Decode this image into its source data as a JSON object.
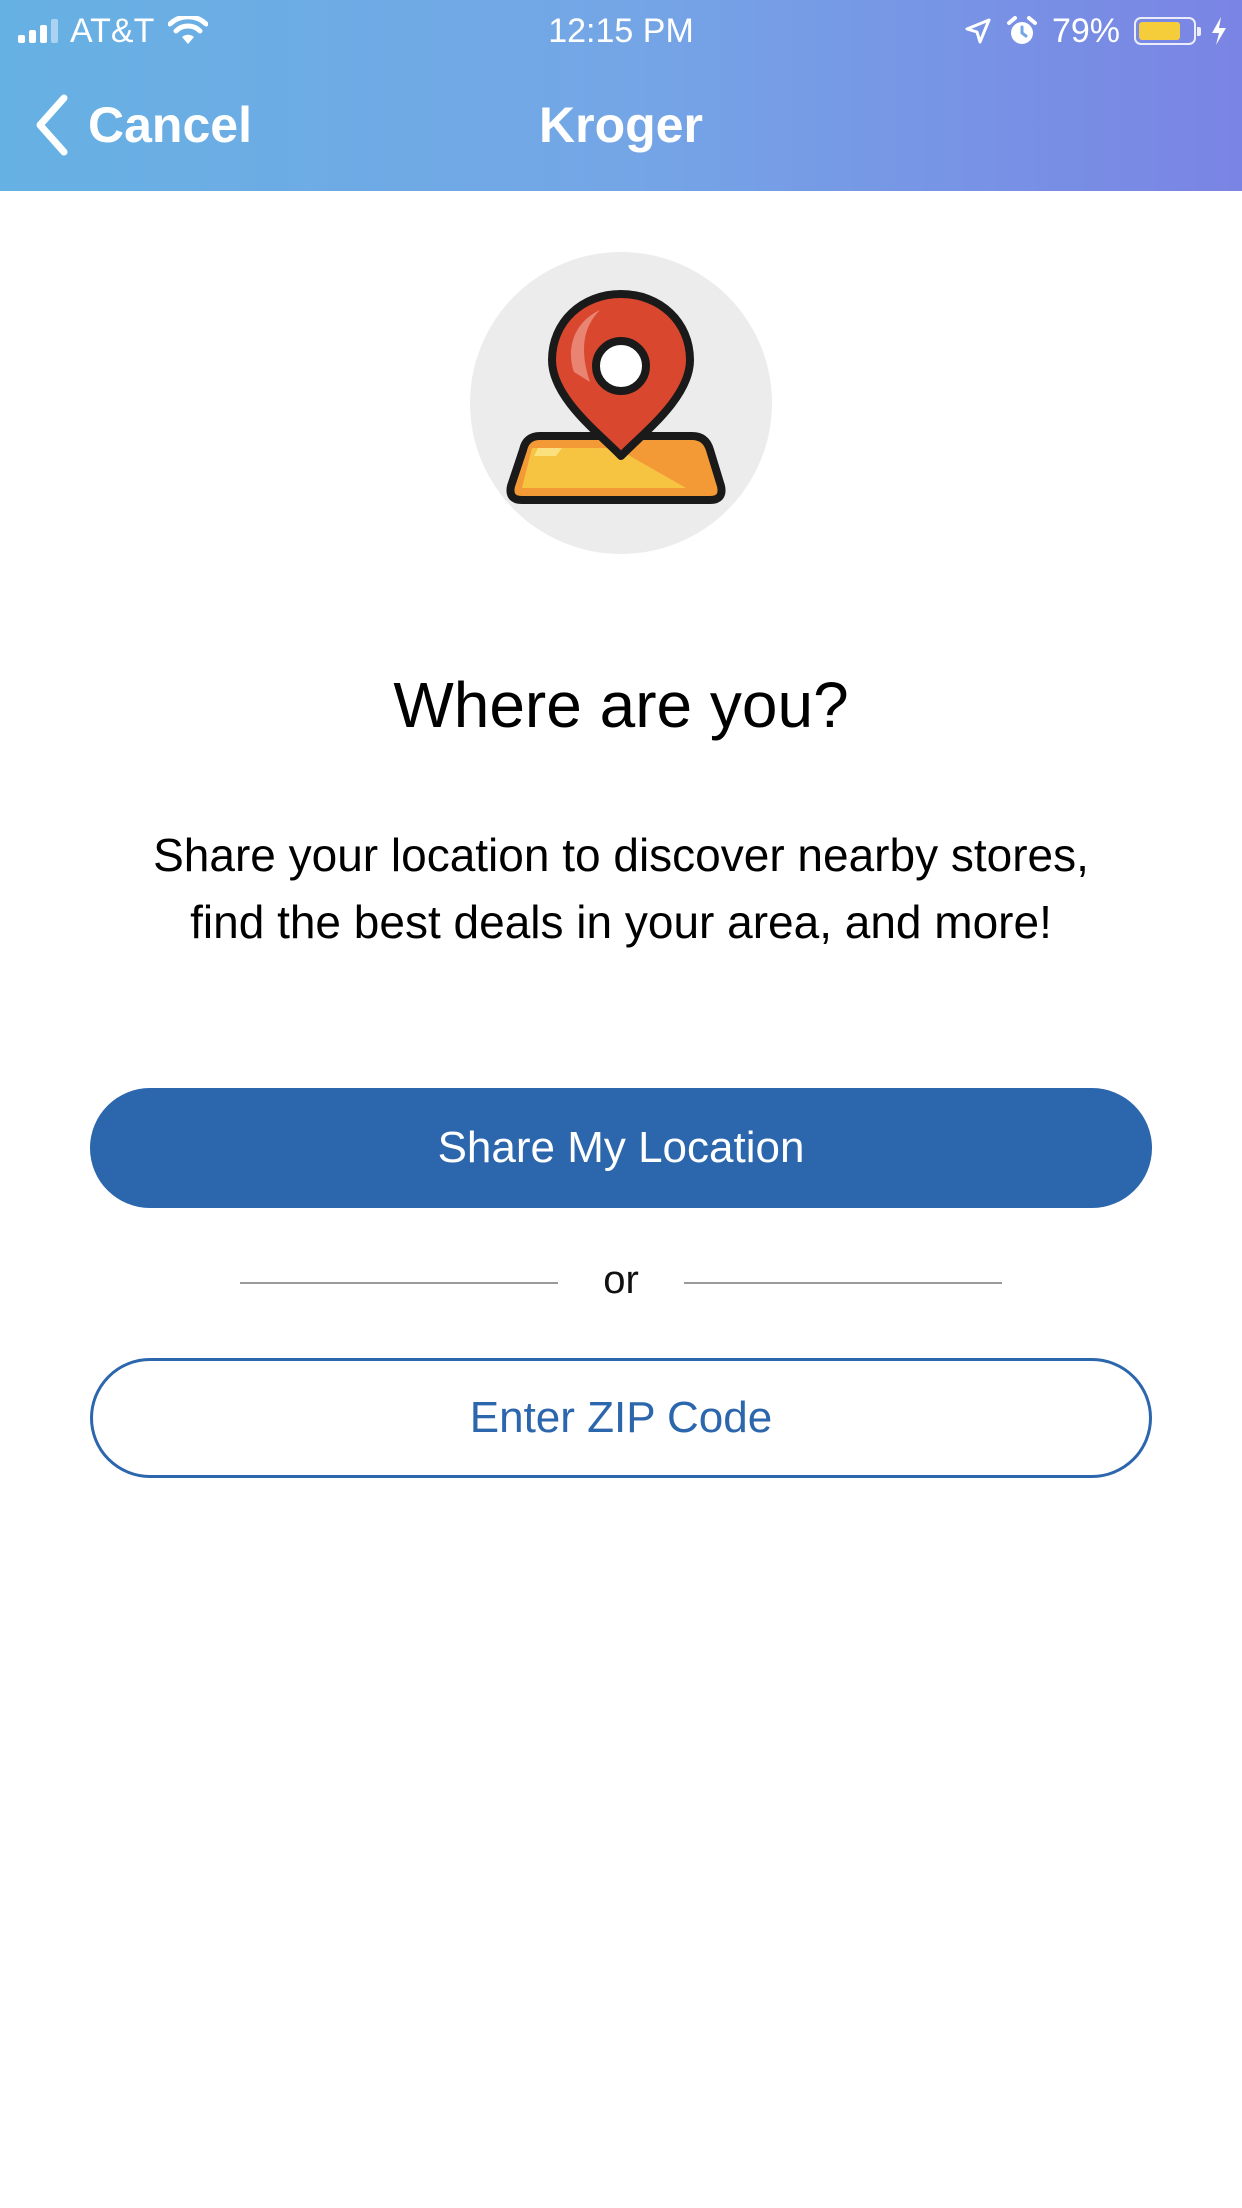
{
  "status_bar": {
    "carrier": "AT&T",
    "time": "12:15 PM",
    "battery_percent": "79%",
    "battery_level": 0.79,
    "icons": [
      "signal-icon",
      "wifi-icon",
      "location-arrow-icon",
      "alarm-icon",
      "battery-icon",
      "charging-bolt-icon"
    ]
  },
  "nav": {
    "back_label": "Cancel",
    "title": "Kroger"
  },
  "hero": {
    "icon": "map-pin-icon"
  },
  "content": {
    "headline": "Where are you?",
    "subtext_line1": "Share your location to discover nearby stores,",
    "subtext_line2": "find the best deals in your area, and more!"
  },
  "actions": {
    "share_location_label": "Share My Location",
    "divider_text": "or",
    "enter_zip_label": "Enter ZIP Code"
  },
  "colors": {
    "header_gradient_start": "#66b1e3",
    "header_gradient_end": "#7a84e4",
    "primary": "#2c66ac",
    "pin_red": "#d9472e",
    "map_orange": "#f39a36"
  }
}
